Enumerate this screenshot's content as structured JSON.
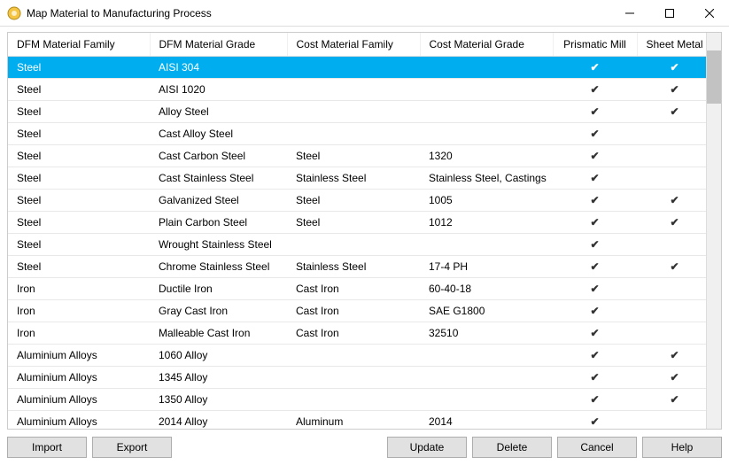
{
  "window": {
    "title": "Map Material to Manufacturing Process"
  },
  "columns": {
    "dfm_family": "DFM Material Family",
    "dfm_grade": "DFM Material Grade",
    "cost_family": "Cost Material Family",
    "cost_grade": "Cost Material Grade",
    "prismatic_mill": "Prismatic Mill",
    "sheet_metal": "Sheet Metal"
  },
  "rows": [
    {
      "dfm_family": "Steel",
      "dfm_grade": "AISI 304",
      "cost_family": "",
      "cost_grade": "",
      "pm": true,
      "sm": true,
      "selected": true
    },
    {
      "dfm_family": "Steel",
      "dfm_grade": "AISI 1020",
      "cost_family": "",
      "cost_grade": "",
      "pm": true,
      "sm": true
    },
    {
      "dfm_family": "Steel",
      "dfm_grade": "Alloy Steel",
      "cost_family": "",
      "cost_grade": "",
      "pm": true,
      "sm": true
    },
    {
      "dfm_family": "Steel",
      "dfm_grade": "Cast Alloy Steel",
      "cost_family": "",
      "cost_grade": "",
      "pm": true,
      "sm": false
    },
    {
      "dfm_family": "Steel",
      "dfm_grade": "Cast Carbon Steel",
      "cost_family": "Steel",
      "cost_grade": "1320",
      "pm": true,
      "sm": false
    },
    {
      "dfm_family": "Steel",
      "dfm_grade": "Cast Stainless Steel",
      "cost_family": "Stainless Steel",
      "cost_grade": "Stainless Steel, Castings",
      "pm": true,
      "sm": false
    },
    {
      "dfm_family": "Steel",
      "dfm_grade": "Galvanized Steel",
      "cost_family": "Steel",
      "cost_grade": "1005",
      "pm": true,
      "sm": true
    },
    {
      "dfm_family": "Steel",
      "dfm_grade": "Plain Carbon Steel",
      "cost_family": "Steel",
      "cost_grade": "1012",
      "pm": true,
      "sm": true
    },
    {
      "dfm_family": "Steel",
      "dfm_grade": "Wrought Stainless Steel",
      "cost_family": "",
      "cost_grade": "",
      "pm": true,
      "sm": false
    },
    {
      "dfm_family": "Steel",
      "dfm_grade": "Chrome Stainless Steel",
      "cost_family": "Stainless Steel",
      "cost_grade": "17-4 PH",
      "pm": true,
      "sm": true
    },
    {
      "dfm_family": "Iron",
      "dfm_grade": "Ductile Iron",
      "cost_family": "Cast Iron",
      "cost_grade": "60-40-18",
      "pm": true,
      "sm": false
    },
    {
      "dfm_family": "Iron",
      "dfm_grade": "Gray Cast Iron",
      "cost_family": "Cast Iron",
      "cost_grade": "SAE G1800",
      "pm": true,
      "sm": false
    },
    {
      "dfm_family": "Iron",
      "dfm_grade": "Malleable Cast Iron",
      "cost_family": "Cast Iron",
      "cost_grade": "32510",
      "pm": true,
      "sm": false
    },
    {
      "dfm_family": "Aluminium Alloys",
      "dfm_grade": "1060 Alloy",
      "cost_family": "",
      "cost_grade": "",
      "pm": true,
      "sm": true
    },
    {
      "dfm_family": "Aluminium Alloys",
      "dfm_grade": "1345 Alloy",
      "cost_family": "",
      "cost_grade": "",
      "pm": true,
      "sm": true
    },
    {
      "dfm_family": "Aluminium Alloys",
      "dfm_grade": "1350 Alloy",
      "cost_family": "",
      "cost_grade": "",
      "pm": true,
      "sm": true
    },
    {
      "dfm_family": "Aluminium Alloys",
      "dfm_grade": "2014 Alloy",
      "cost_family": "Aluminum",
      "cost_grade": "2014",
      "pm": true,
      "sm": false
    }
  ],
  "buttons": {
    "import": "Import",
    "export": "Export",
    "update": "Update",
    "delete": "Delete",
    "cancel": "Cancel",
    "help": "Help"
  },
  "glyphs": {
    "check": "✔"
  }
}
